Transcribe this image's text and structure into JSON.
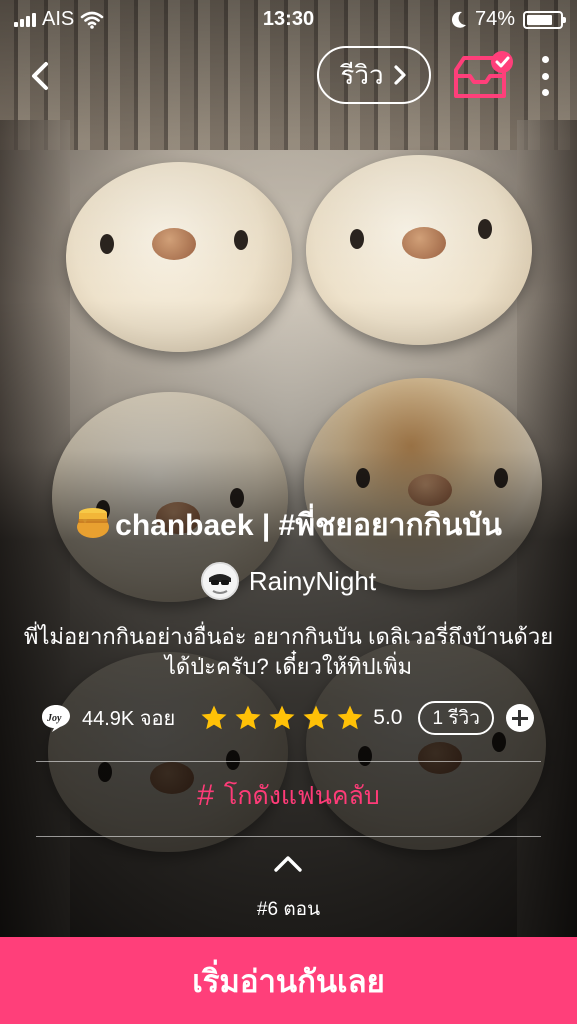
{
  "status_bar": {
    "carrier": "AIS",
    "time": "13:30",
    "battery": "74%",
    "battery_level": 0.74
  },
  "nav": {
    "review_label": "รีวิว",
    "icons": [
      "back-chevron-icon",
      "chevron-right-icon",
      "inbox-check-icon",
      "more-vertical-icon"
    ]
  },
  "story": {
    "title": "chanbaek | #พี่ชยอยากกินบัน",
    "author": "RainyNight",
    "description": "พี่ไม่อยากกินอย่างอื่นอ่ะ อยากกินบัน เดลิเวอรี่ถึงบ้านด้วยได้ป่ะครับ? เดี๋ยวให้ทิปเพิ่ม",
    "joy_count": "44.9K จอย",
    "rating": "5.0",
    "stars": 5,
    "review_count": "1 รีวิว",
    "fanclub_label": "โกดังแฟนคลับ",
    "episode_count": "#6 ตอน"
  },
  "cta": {
    "label": "เริ่มอ่านกันเลย"
  },
  "colors": {
    "accent": "#ff3f7a",
    "star": "#ffc107",
    "text": "#ffffff"
  }
}
